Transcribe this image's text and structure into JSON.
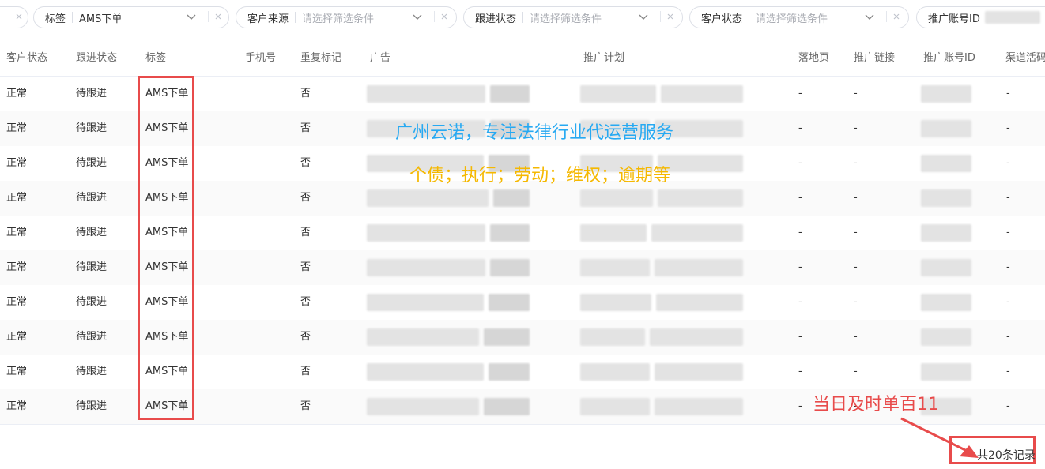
{
  "filters": [
    {
      "label": "标签",
      "value": "AMS下单",
      "placeholder": ""
    },
    {
      "label": "客户来源",
      "value": "",
      "placeholder": "请选择筛选条件"
    },
    {
      "label": "跟进状态",
      "value": "",
      "placeholder": "请选择筛选条件"
    },
    {
      "label": "客户状态",
      "value": "",
      "placeholder": "请选择筛选条件"
    },
    {
      "label": "推广账号ID",
      "value": "",
      "placeholder": ""
    }
  ],
  "table": {
    "columns": [
      "客户状态",
      "跟进状态",
      "标签",
      "手机号",
      "重复标记",
      "广告",
      "推广计划",
      "落地页",
      "推广链接",
      "推广账号ID",
      "渠道活码"
    ],
    "rows": [
      {
        "status": "正常",
        "follow": "待跟进",
        "tag": "AMS下单",
        "phone": "",
        "repeat": "否",
        "landing": "-",
        "link": "-",
        "channel": "-"
      },
      {
        "status": "正常",
        "follow": "待跟进",
        "tag": "AMS下单",
        "phone": "",
        "repeat": "否",
        "landing": "-",
        "link": "-",
        "channel": "-"
      },
      {
        "status": "正常",
        "follow": "待跟进",
        "tag": "AMS下单",
        "phone": "",
        "repeat": "否",
        "landing": "-",
        "link": "-",
        "channel": "-"
      },
      {
        "status": "正常",
        "follow": "待跟进",
        "tag": "AMS下单",
        "phone": "",
        "repeat": "否",
        "landing": "-",
        "link": "-",
        "channel": "-"
      },
      {
        "status": "正常",
        "follow": "待跟进",
        "tag": "AMS下单",
        "phone": "",
        "repeat": "否",
        "landing": "-",
        "link": "-",
        "channel": "-"
      },
      {
        "status": "正常",
        "follow": "待跟进",
        "tag": "AMS下单",
        "phone": "",
        "repeat": "否",
        "landing": "-",
        "link": "-",
        "channel": "-"
      },
      {
        "status": "正常",
        "follow": "待跟进",
        "tag": "AMS下单",
        "phone": "",
        "repeat": "否",
        "landing": "-",
        "link": "-",
        "channel": "-"
      },
      {
        "status": "正常",
        "follow": "待跟进",
        "tag": "AMS下单",
        "phone": "",
        "repeat": "否",
        "landing": "-",
        "link": "-",
        "channel": "-"
      },
      {
        "status": "正常",
        "follow": "待跟进",
        "tag": "AMS下单",
        "phone": "",
        "repeat": "否",
        "landing": "-",
        "link": "-",
        "channel": "-"
      },
      {
        "status": "正常",
        "follow": "待跟进",
        "tag": "AMS下单",
        "phone": "",
        "repeat": "否",
        "landing": "-",
        "link": "-",
        "channel": "-"
      }
    ]
  },
  "overlay": {
    "line1": "广州云诺，专注法律行业代运营服务",
    "line2": "个债；执行；劳动；维权；逾期等",
    "annotation": "当日及时单百11",
    "line1_color": "#27a9f2",
    "line2_color": "#f5b800",
    "annotation_color": "#e84b4b"
  },
  "pagination": {
    "total_text": "共20条记录"
  },
  "icons": [
    "chevron-down-icon",
    "clear-icon",
    "arrow-icon"
  ]
}
